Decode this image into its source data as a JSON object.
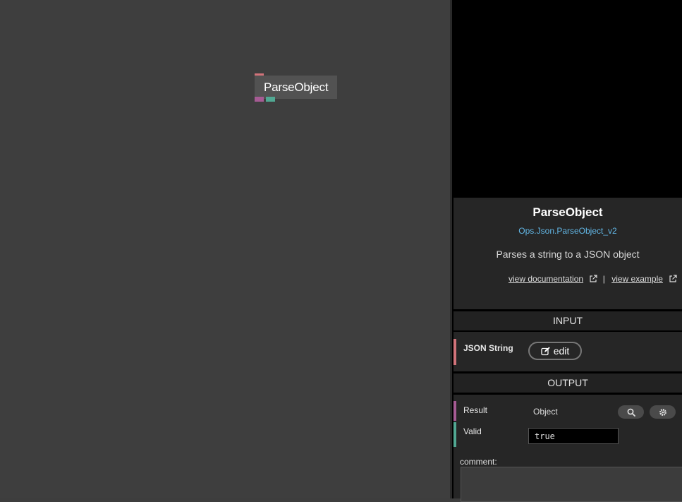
{
  "canvas": {
    "op_node": {
      "title": "ParseObject"
    }
  },
  "op_info": {
    "name": "ParseObject",
    "namespace": "Ops.Json.ParseObject_v2",
    "description": "Parses a string to a JSON object",
    "view_documentation": "view documentation",
    "separator": "|",
    "view_example": "view example"
  },
  "input_section": {
    "heading": "INPUT",
    "ports": [
      {
        "label": "JSON String",
        "button": "edit",
        "color": "#d2737a"
      }
    ]
  },
  "output_section": {
    "heading": "OUTPUT",
    "ports": [
      {
        "label": "Result",
        "value": "Object",
        "color": "#a65b94"
      },
      {
        "label": "Valid",
        "value": "true",
        "color": "#51a893"
      }
    ]
  },
  "comment": {
    "label": "comment:",
    "value": ""
  },
  "colors": {
    "port_string": "#d2737a",
    "port_object": "#a65b94",
    "port_bool": "#51a893",
    "link": "#62b7e6"
  },
  "icons": {
    "external_link": "external-link-icon",
    "edit": "edit-icon",
    "search": "search-icon",
    "settings": "gear-icon"
  }
}
